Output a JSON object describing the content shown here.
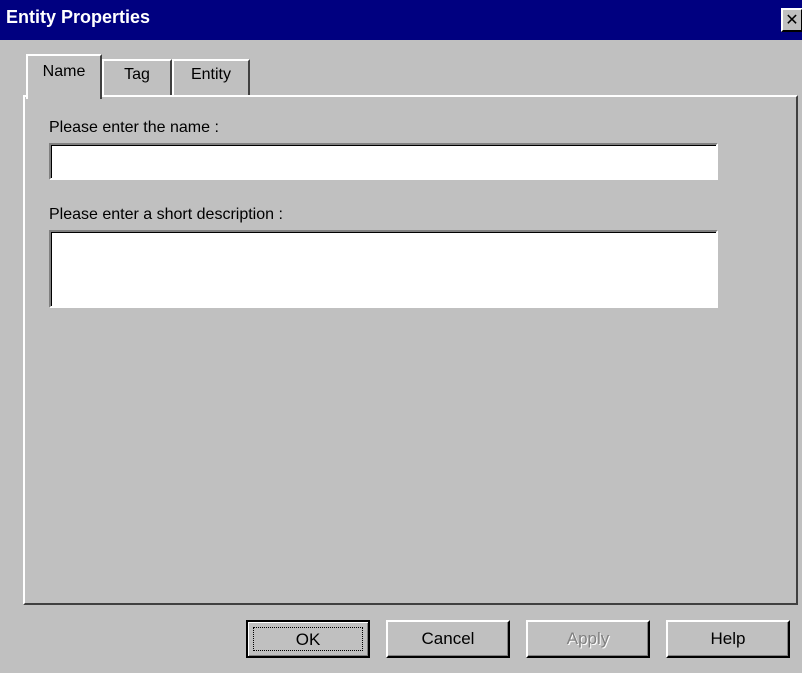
{
  "window": {
    "title": "Entity Properties",
    "close_glyph": "✕"
  },
  "tabs": [
    {
      "label": "Name",
      "active": true
    },
    {
      "label": "Tag",
      "active": false
    },
    {
      "label": "Entity",
      "active": false
    }
  ],
  "form": {
    "name_label": "Please enter the name :",
    "name_value": "",
    "description_label": "Please enter a short description :",
    "description_value": ""
  },
  "buttons": {
    "ok": "OK",
    "cancel": "Cancel",
    "apply": "Apply",
    "help": "Help"
  },
  "colors": {
    "titlebar": "#000080",
    "face": "#c0c0c0",
    "disabled_text": "#808080"
  }
}
